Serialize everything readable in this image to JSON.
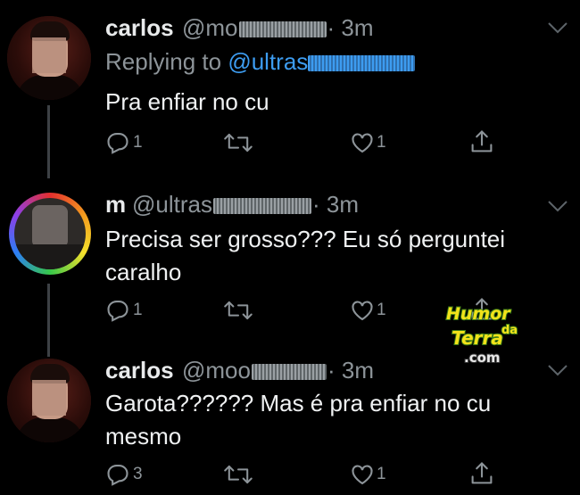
{
  "tweets": [
    {
      "name": "carlos",
      "handle_prefix": "@mo",
      "time": "· 3m",
      "replying_label": "Replying to",
      "replying_handle": "@ultras",
      "text": "Pra enfiar no cu",
      "reply_count": "1",
      "retweet_count": "",
      "like_count": "1"
    },
    {
      "name": "m",
      "handle_prefix": "@ultras",
      "time": "· 3m",
      "text": "Precisa ser grosso??? Eu só perguntei caralho",
      "reply_count": "1",
      "retweet_count": "",
      "like_count": "1"
    },
    {
      "name": "carlos",
      "handle_prefix": "@moo",
      "time": "· 3m",
      "text": "Garota?????? Mas é pra enfiar no cu mesmo",
      "reply_count": "3",
      "retweet_count": "",
      "like_count": "1"
    }
  ],
  "watermark": {
    "line1": "Humor",
    "line2": "da",
    "line3": "Terra",
    "line4": ".com"
  },
  "icons": [
    "reply-icon",
    "retweet-icon",
    "like-icon",
    "share-icon",
    "chevron-down-icon"
  ],
  "colors": {
    "background": "#000000",
    "link": "#3d9cf0",
    "secondary": "#8d9499"
  }
}
